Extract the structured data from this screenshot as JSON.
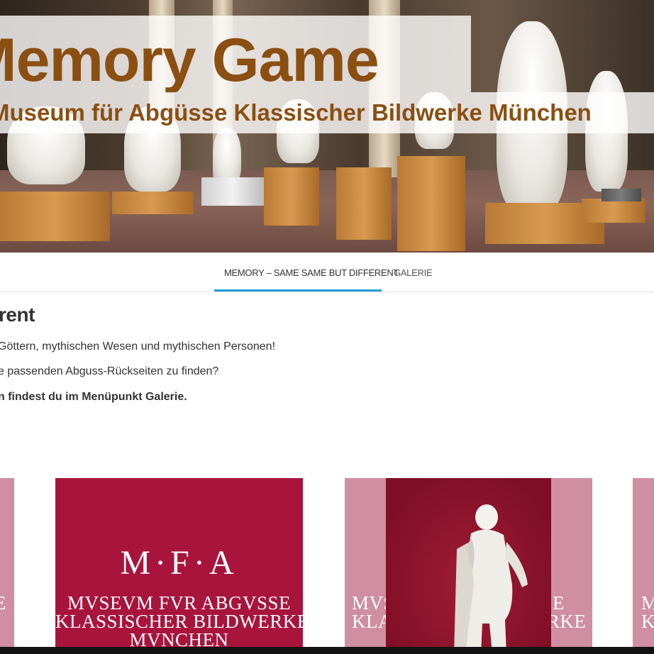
{
  "header": {
    "title": "Memory Game",
    "subtitle": "Museum für Abgüsse Klassischer Bildwerke München"
  },
  "nav": {
    "items": [
      {
        "label": "Memory – Same same but different",
        "active": true
      },
      {
        "label": "Galerie",
        "active": false
      }
    ],
    "accent_color": "#1e9fd6"
  },
  "content": {
    "heading": "rent",
    "paragraphs": [
      "Göttern, mythischen Wesen und mythischen Personen!",
      "e passenden Abguss-Rückseiten zu finden?",
      "n findest du im Menüpunkt Galerie."
    ]
  },
  "cards": {
    "logo_big": "M·F·A",
    "logo_lines": [
      "MVSEVM FVR ABGVSSE",
      "KLASSISCHER BILDWERKE",
      "MVNCHEN"
    ],
    "partial_left": "E",
    "partial_mid_top": "MVS",
    "partial_mid_bottom": "KLA",
    "partial_mid_right_top": "E",
    "partial_mid_right_bottom": "ERKE",
    "partial_right_top": "M",
    "partial_right_bottom": "K",
    "brand_color": "#a8143c"
  }
}
